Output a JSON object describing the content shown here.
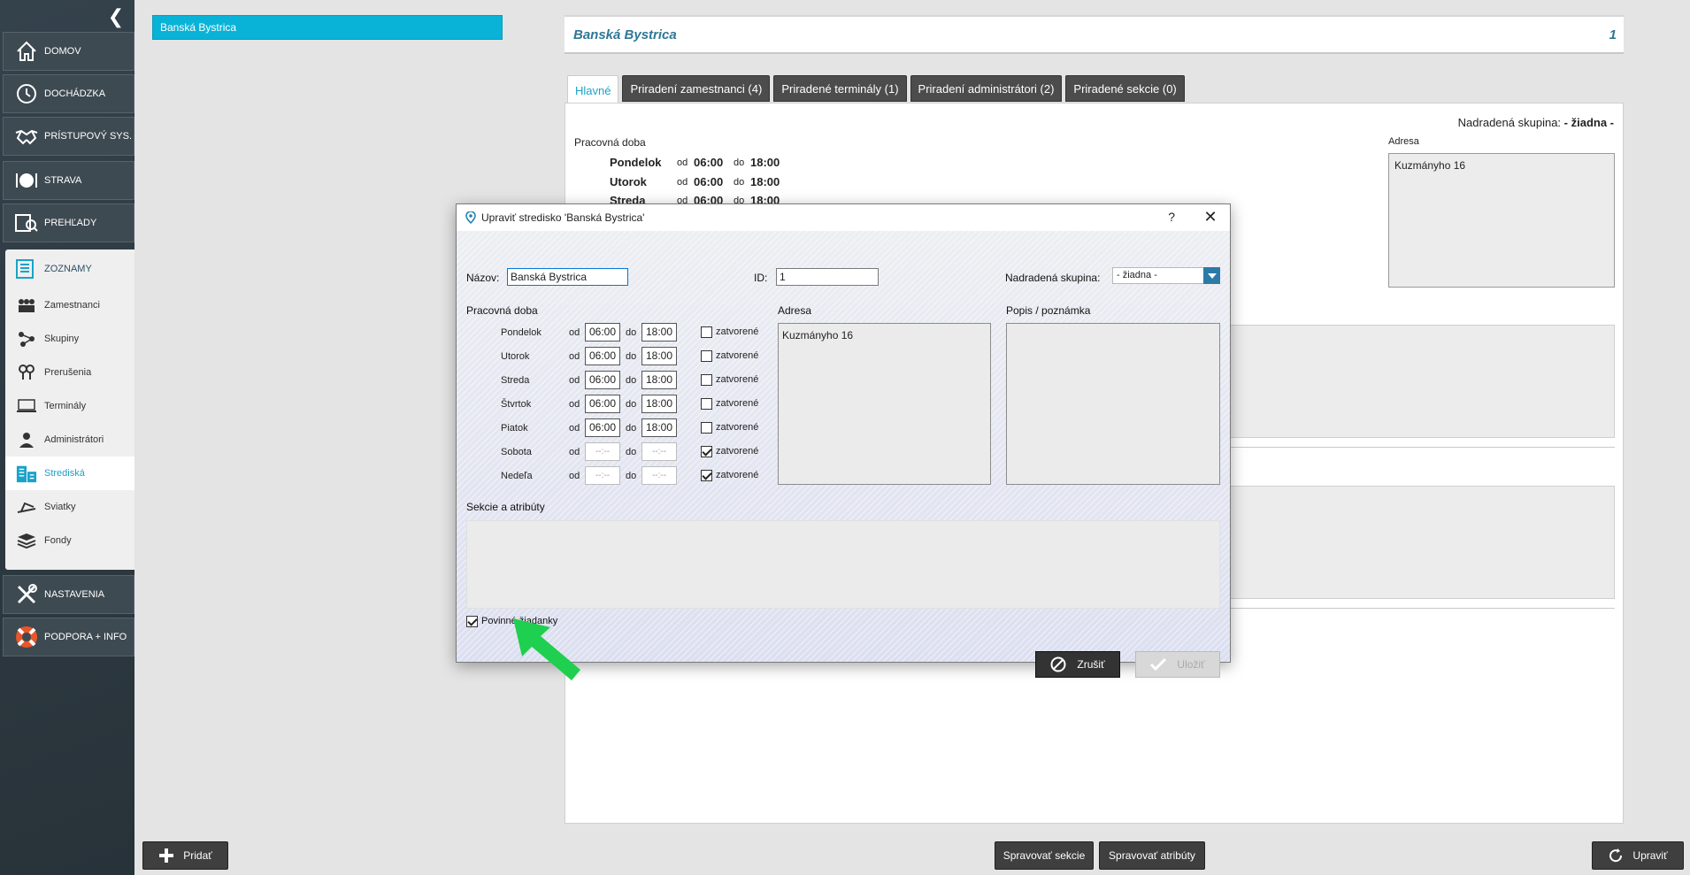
{
  "sidebar": {
    "collapse_icon": "chevron-left-double-icon",
    "main_items": [
      {
        "label": "DOMOV",
        "icon": "home-icon"
      },
      {
        "label": "DOCHÁDZKA",
        "icon": "clock-icon"
      },
      {
        "label": "PRÍSTUPOVÝ SYS.",
        "icon": "handshake-icon"
      },
      {
        "label": "STRAVA",
        "icon": "plate-icon"
      },
      {
        "label": "PREHĽADY",
        "icon": "report-icon"
      }
    ],
    "sub_header": "ZOZNAMY",
    "sub_items": [
      {
        "label": "Zamestnanci",
        "icon": "people-icon"
      },
      {
        "label": "Skupiny",
        "icon": "groups-icon"
      },
      {
        "label": "Prerušenia",
        "icon": "interruption-icon"
      },
      {
        "label": "Terminály",
        "icon": "terminal-icon"
      },
      {
        "label": "Administrátori",
        "icon": "admin-icon"
      },
      {
        "label": "Strediská",
        "icon": "buildings-icon"
      },
      {
        "label": "Sviatky",
        "icon": "holiday-icon"
      },
      {
        "label": "Fondy",
        "icon": "layers-icon"
      }
    ],
    "bottom_items": [
      {
        "label": "NASTAVENIA",
        "icon": "tools-icon"
      },
      {
        "label": "PODPORA + INFO",
        "icon": "lifebuoy-icon"
      }
    ]
  },
  "list": {
    "selected": "Banská Bystrica"
  },
  "detail": {
    "title": "Banská Bystrica",
    "id": "1",
    "tabs": [
      "Hlavné",
      "Priradení zamestnanci (4)",
      "Priradené terminály (1)",
      "Priradení administrátori (2)",
      "Priradené sekcie (0)"
    ],
    "parent_label": "Nadradená skupina:",
    "parent_value": "- žiadna -",
    "work_hours_label": "Pracovná doba",
    "address_label": "Adresa",
    "address_value": "Kuzmányho 16",
    "od": "od",
    "do": "do",
    "days": [
      {
        "name": "Pondelok",
        "from": "06:00",
        "to": "18:00"
      },
      {
        "name": "Utorok",
        "from": "06:00",
        "to": "18:00"
      },
      {
        "name": "Streda",
        "from": "06:00",
        "to": "18:00"
      }
    ]
  },
  "bottom_bar": {
    "add": "Pridať",
    "manage_sections": "Spravovať sekcie",
    "manage_attributes": "Spravovať atribúty",
    "edit": "Upraviť"
  },
  "dialog": {
    "title": "Upraviť stredisko 'Banská Bystrica'",
    "help": "?",
    "name_label": "Názov:",
    "name_value": "Banská Bystrica",
    "id_label": "ID:",
    "id_value": "1",
    "parent_label": "Nadradená skupina:",
    "parent_value": "- žiadna -",
    "work_hours_label": "Pracovná doba",
    "od": "od",
    "do": "do",
    "closed_label": "zatvorené",
    "days": [
      {
        "name": "Pondelok",
        "from": "06:00",
        "to": "18:00",
        "closed": false
      },
      {
        "name": "Utorok",
        "from": "06:00",
        "to": "18:00",
        "closed": false
      },
      {
        "name": "Streda",
        "from": "06:00",
        "to": "18:00",
        "closed": false
      },
      {
        "name": "Štvrtok",
        "from": "06:00",
        "to": "18:00",
        "closed": false
      },
      {
        "name": "Piatok",
        "from": "06:00",
        "to": "18:00",
        "closed": false
      },
      {
        "name": "Sobota",
        "from": "--:--",
        "to": "--:--",
        "closed": true
      },
      {
        "name": "Nedeľa",
        "from": "--:--",
        "to": "--:--",
        "closed": true
      }
    ],
    "address_label": "Adresa",
    "address_value": "Kuzmányho 16",
    "note_label": "Popis / poznámka",
    "note_value": "",
    "sections_label": "Sekcie a atribúty",
    "mandatory_label": "Povinné žiadanky",
    "mandatory_checked": true,
    "cancel": "Zrušiť",
    "save": "Uložiť"
  },
  "colors": {
    "accent": "#09b3d8",
    "arrow": "#1fcf4f",
    "sidebar": "#2f3b44"
  }
}
